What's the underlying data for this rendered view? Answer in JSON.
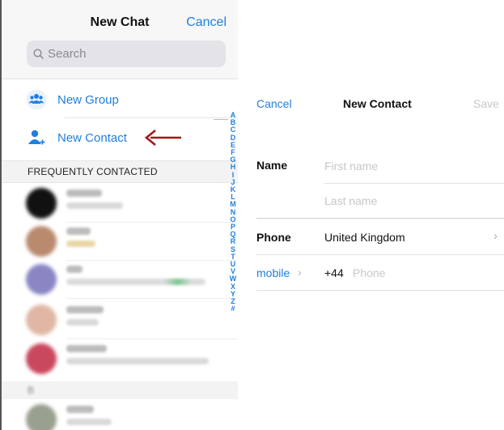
{
  "new_chat": {
    "title": "New Chat",
    "cancel_label": "Cancel",
    "search_placeholder": "Search",
    "new_group_label": "New Group",
    "new_contact_label": "New Contact",
    "frequently_contacted_label": "FREQUENTLY CONTACTED",
    "section_b_label": "B",
    "index_letters": [
      "A",
      "B",
      "C",
      "D",
      "E",
      "F",
      "G",
      "H",
      "I",
      "J",
      "K",
      "L",
      "M",
      "N",
      "O",
      "P",
      "Q",
      "R",
      "S",
      "T",
      "U",
      "V",
      "W",
      "X",
      "Y",
      "Z",
      "#"
    ],
    "accent_color": "#1f7fe0",
    "annotation_arrow_color": "#a01a1a"
  },
  "new_contact": {
    "cancel_label": "Cancel",
    "title": "New Contact",
    "save_label": "Save",
    "name_label": "Name",
    "first_name_placeholder": "First name",
    "last_name_placeholder": "Last name",
    "phone_label": "Phone",
    "country": "United Kingdom",
    "phone_type_label": "mobile",
    "country_code": "+44",
    "phone_placeholder": "Phone"
  }
}
